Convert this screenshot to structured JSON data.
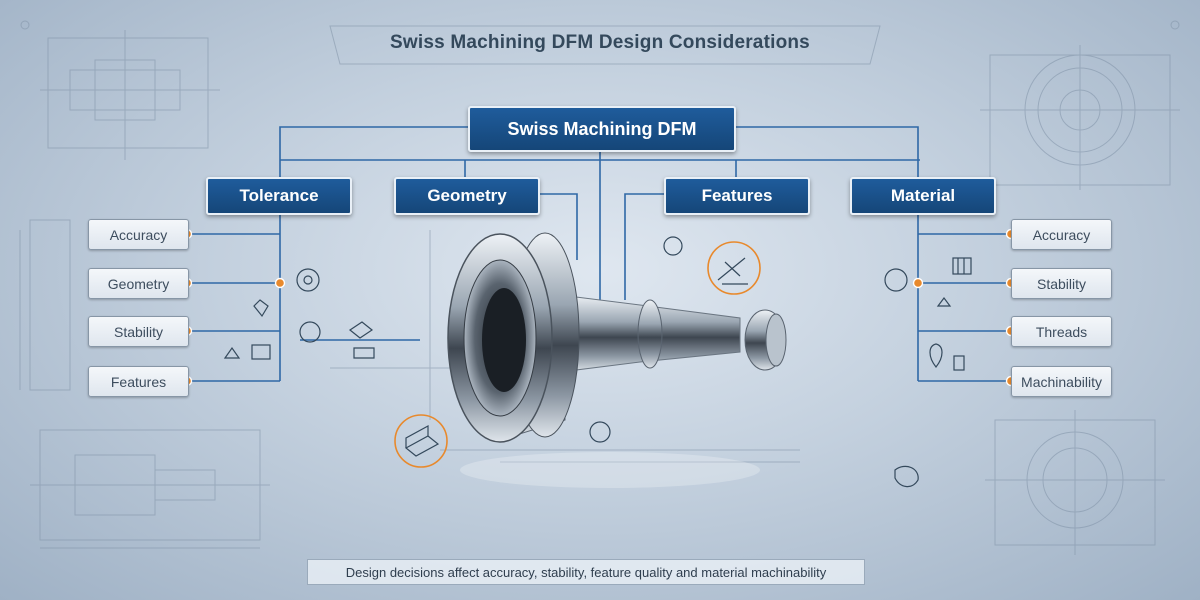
{
  "title": "Swiss Machining DFM Design Considerations",
  "root": {
    "label": "Swiss Machining DFM"
  },
  "categories": [
    {
      "label": "Tolerance"
    },
    {
      "label": "Geometry"
    },
    {
      "label": "Features"
    },
    {
      "label": "Material"
    }
  ],
  "left_items": [
    {
      "label": "Accuracy"
    },
    {
      "label": "Geometry"
    },
    {
      "label": "Stability"
    },
    {
      "label": "Features"
    }
  ],
  "right_items": [
    {
      "label": "Accuracy"
    },
    {
      "label": "Stability"
    },
    {
      "label": "Threads"
    },
    {
      "label": "Machinability"
    }
  ],
  "caption": "Design decisions affect accuracy, stability, feature quality and material machinability",
  "colors": {
    "node_fill": "#1a518a",
    "connector": "#2f68a6",
    "dot": "#e8892c"
  },
  "icons": [
    "gear-icon",
    "tool-icon",
    "lathe-icon",
    "thread-icon",
    "location-pin-icon"
  ]
}
